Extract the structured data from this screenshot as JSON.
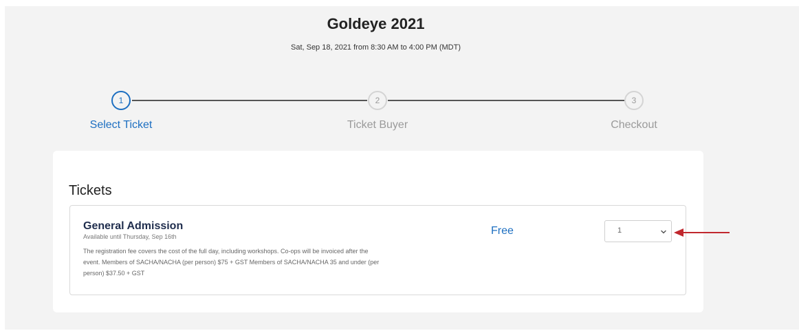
{
  "event": {
    "title": "Goldeye 2021",
    "date": "Sat, Sep 18, 2021 from 8:30 AM to 4:00 PM (MDT)"
  },
  "steps": [
    {
      "number": "1",
      "label": "Select Ticket",
      "active": true
    },
    {
      "number": "2",
      "label": "Ticket Buyer",
      "active": false
    },
    {
      "number": "3",
      "label": "Checkout",
      "active": false
    }
  ],
  "tickets": {
    "heading": "Tickets",
    "items": [
      {
        "name": "General Admission",
        "availability": "Available until Thursday, Sep 16th",
        "description": "The registration fee covers the cost of the full day, including workshops. Co-ops will be invoiced after the event. Members of SACHA/NACHA (per person) $75 + GST Members of SACHA/NACHA 35 and under (per person) $37.50 + GST",
        "price": "Free",
        "quantity": "1"
      }
    ]
  },
  "colors": {
    "accent": "#1d6fc1",
    "inactive": "#9a9a9a",
    "annotation_arrow": "#c0272d"
  },
  "icons": {
    "quantity_dropdown": "chevron-down-icon",
    "annotation": "arrow-left-icon"
  }
}
